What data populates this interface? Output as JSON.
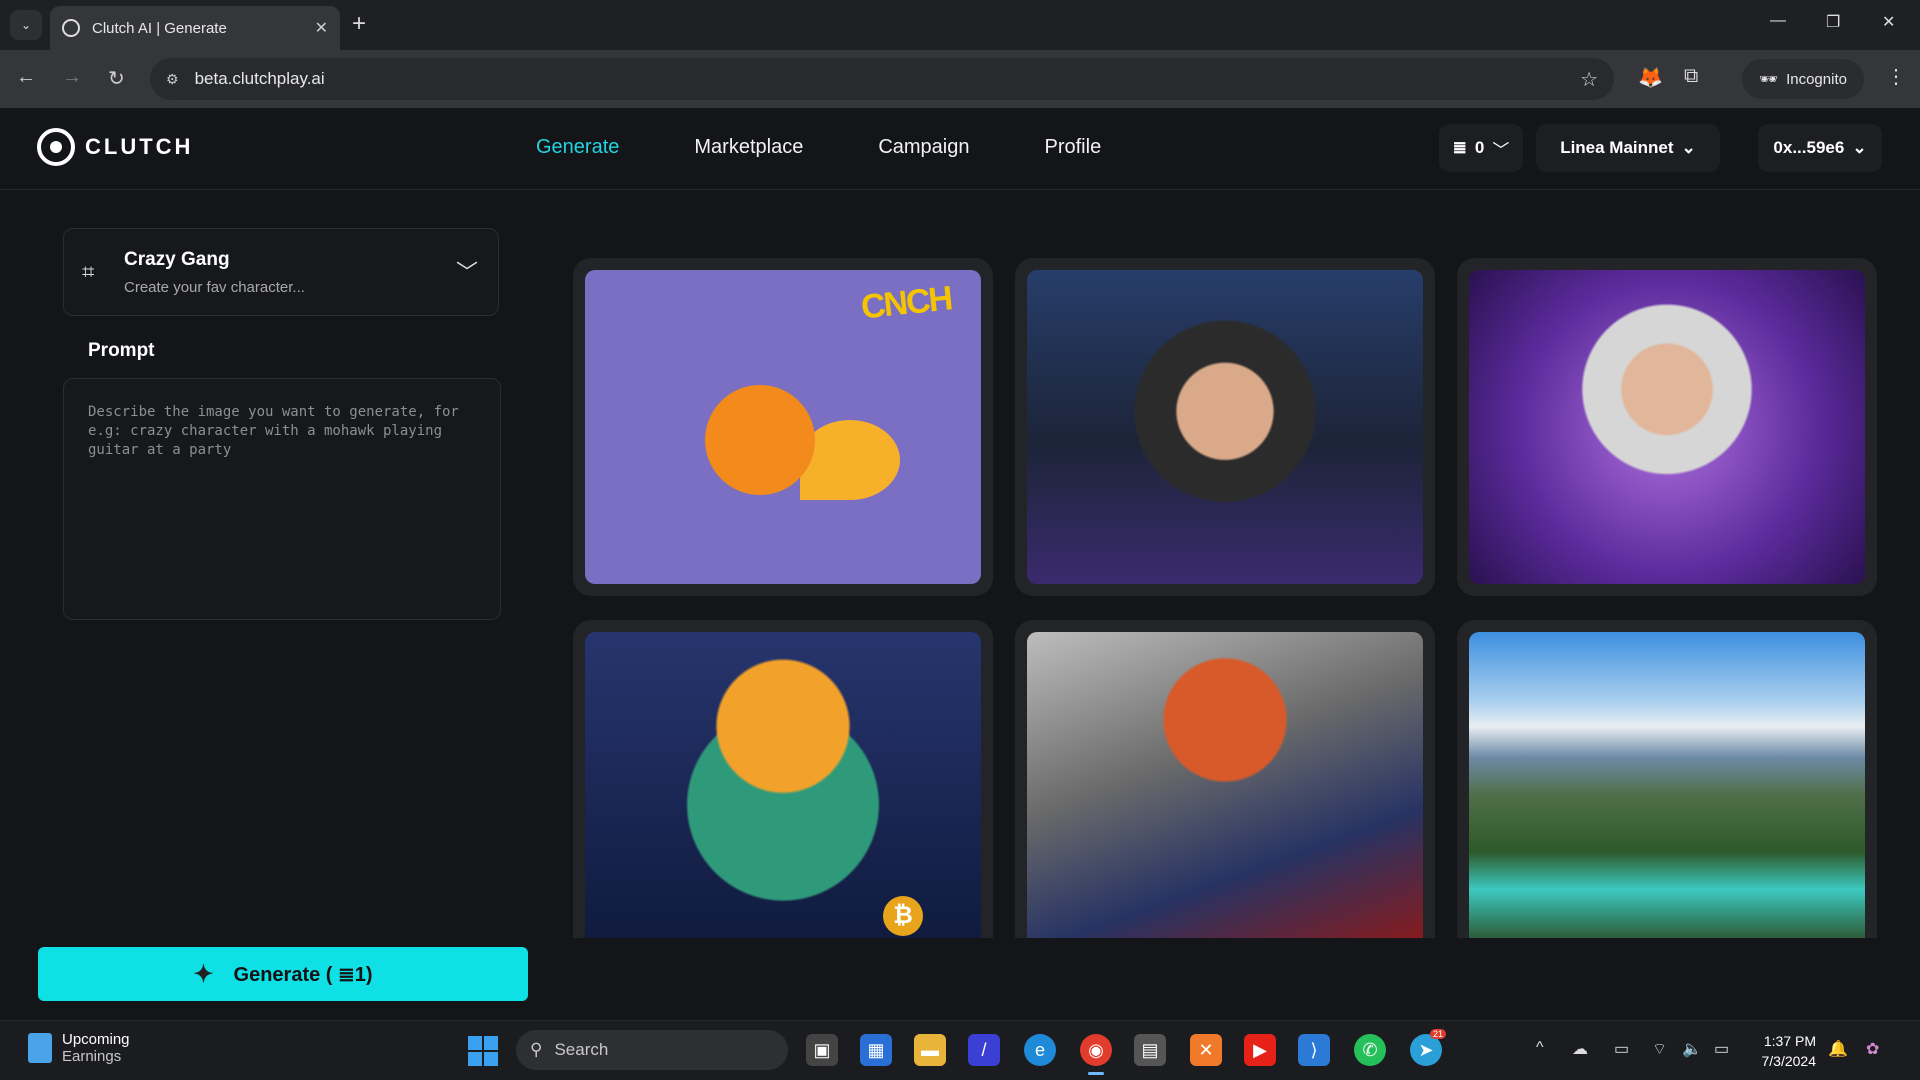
{
  "browser": {
    "tab_title": "Clutch AI | Generate",
    "url": "beta.clutchplay.ai",
    "incognito_label": "Incognito"
  },
  "header": {
    "logo_text": "CLUTCH",
    "nav": [
      {
        "label": "Generate",
        "active": true
      },
      {
        "label": "Marketplace",
        "active": false
      },
      {
        "label": "Campaign",
        "active": false
      },
      {
        "label": "Profile",
        "active": false
      }
    ],
    "credits": "0",
    "network": "Linea Mainnet",
    "wallet": "0x...59e6"
  },
  "sidebar": {
    "model_name": "Crazy Gang",
    "model_desc": "Create your fav character...",
    "prompt_label": "Prompt",
    "prompt_placeholder": "Describe the image you want to generate, for e.g: crazy character with a mohawk playing guitar at a party",
    "generate_label": "Generate ( ",
    "generate_cost": "1)"
  },
  "gallery": {
    "fox_logo_text": "CNCH"
  },
  "taskbar": {
    "weather_top": "Upcoming",
    "weather_bottom": "Earnings",
    "search_placeholder": "Search",
    "time": "1:37 PM",
    "date": "7/3/2024",
    "telegram_badge": "21"
  },
  "colors": {
    "accent": "#22d3e0",
    "generate_button": "#0fe0e6",
    "background": "#141518"
  }
}
